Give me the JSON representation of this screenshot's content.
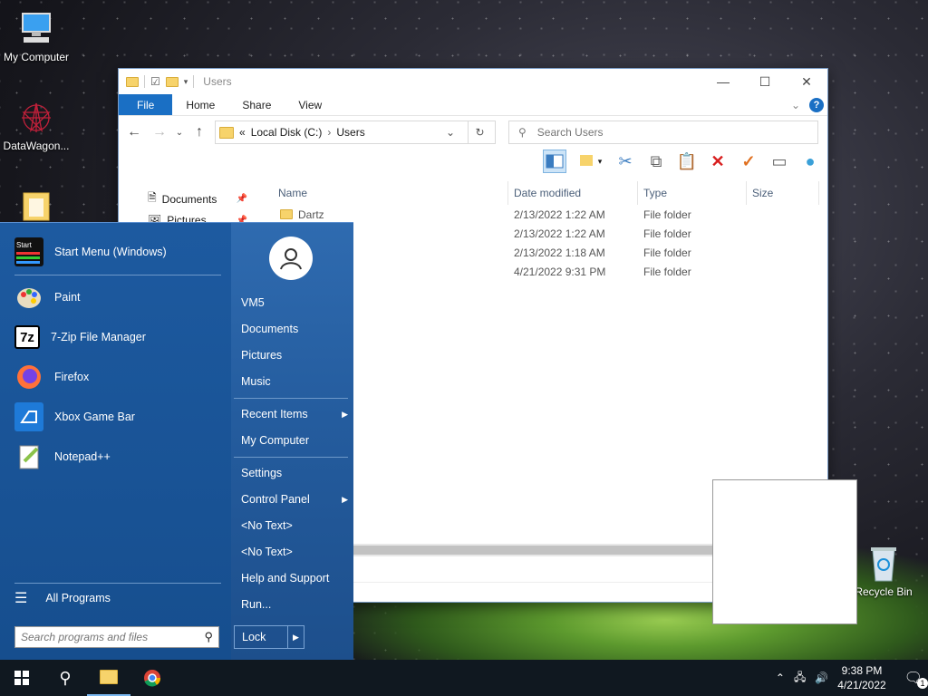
{
  "desktop": {
    "icons": [
      {
        "label": "My Computer"
      },
      {
        "label": "DataWagon..."
      },
      {
        "label": ""
      },
      {
        "label": "Recycle Bin"
      }
    ]
  },
  "explorer": {
    "title": "Users",
    "ribbon_tabs": [
      "File",
      "Home",
      "Share",
      "View"
    ],
    "address": {
      "prefix": "«",
      "crumbs": [
        "Local Disk (C:)",
        "Users"
      ]
    },
    "search_placeholder": "Search Users",
    "nav_items": [
      {
        "label": "Documents"
      },
      {
        "label": "Pictures"
      }
    ],
    "columns": [
      "Name",
      "Date modified",
      "Type",
      "Size"
    ],
    "rows": [
      {
        "name": "Dartz",
        "date": "2/13/2022 1:22 AM",
        "type": "File folder"
      },
      {
        "name": "",
        "date": "2/13/2022 1:22 AM",
        "type": "File folder"
      },
      {
        "name": "",
        "date": "2/13/2022 1:18 AM",
        "type": "File folder"
      },
      {
        "name": "",
        "date": "4/21/2022 9:31 PM",
        "type": "File folder"
      }
    ]
  },
  "start_menu": {
    "apps": [
      {
        "label": "Start Menu (Windows)",
        "icon": "start-menu-app-icon"
      },
      {
        "label": "Paint",
        "icon": "paint-icon"
      },
      {
        "label": "7-Zip File Manager",
        "icon": "7zip-icon"
      },
      {
        "label": "Firefox",
        "icon": "firefox-icon"
      },
      {
        "label": "Xbox Game Bar",
        "icon": "xbox-game-bar-icon"
      },
      {
        "label": "Notepad++",
        "icon": "notepad-plus-plus-icon"
      }
    ],
    "all_programs": "All Programs",
    "search_placeholder": "Search programs and files",
    "right_items": [
      {
        "label": "VM5"
      },
      {
        "label": "Documents"
      },
      {
        "label": "Pictures"
      },
      {
        "label": "Music"
      },
      {
        "label": "Recent Items"
      },
      {
        "label": "My Computer"
      },
      {
        "label": "Settings"
      },
      {
        "label": "Control Panel"
      },
      {
        "label": "<No Text>"
      },
      {
        "label": "<No Text>"
      },
      {
        "label": "Help and Support"
      },
      {
        "label": "Run..."
      }
    ],
    "lock": "Lock"
  },
  "taskbar": {
    "time": "9:38 PM",
    "date": "4/21/2022",
    "notification_count": "1"
  },
  "colors": {
    "accent": "#1a6fc4",
    "start_bg": "#245c9e",
    "taskbar": "#101820"
  }
}
